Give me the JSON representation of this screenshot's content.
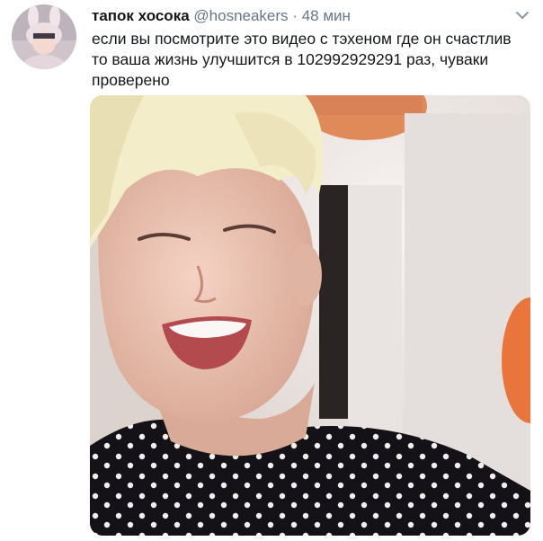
{
  "tweet": {
    "display_name": "тапок хосока",
    "handle": "@hosneakers",
    "separator": "·",
    "time": "48 мин",
    "text": "если вы посмотрите это видео с тэхеном где он счастлив то ваша жизнь улучшится в 102992929291 раз, чуваки проверено",
    "avatar_icon": "profile-avatar",
    "menu_icon": "chevron-down-icon",
    "media_type": "video-thumbnail"
  },
  "colors": {
    "text_primary": "#14171a",
    "text_secondary": "#657786",
    "background": "#ffffff"
  }
}
